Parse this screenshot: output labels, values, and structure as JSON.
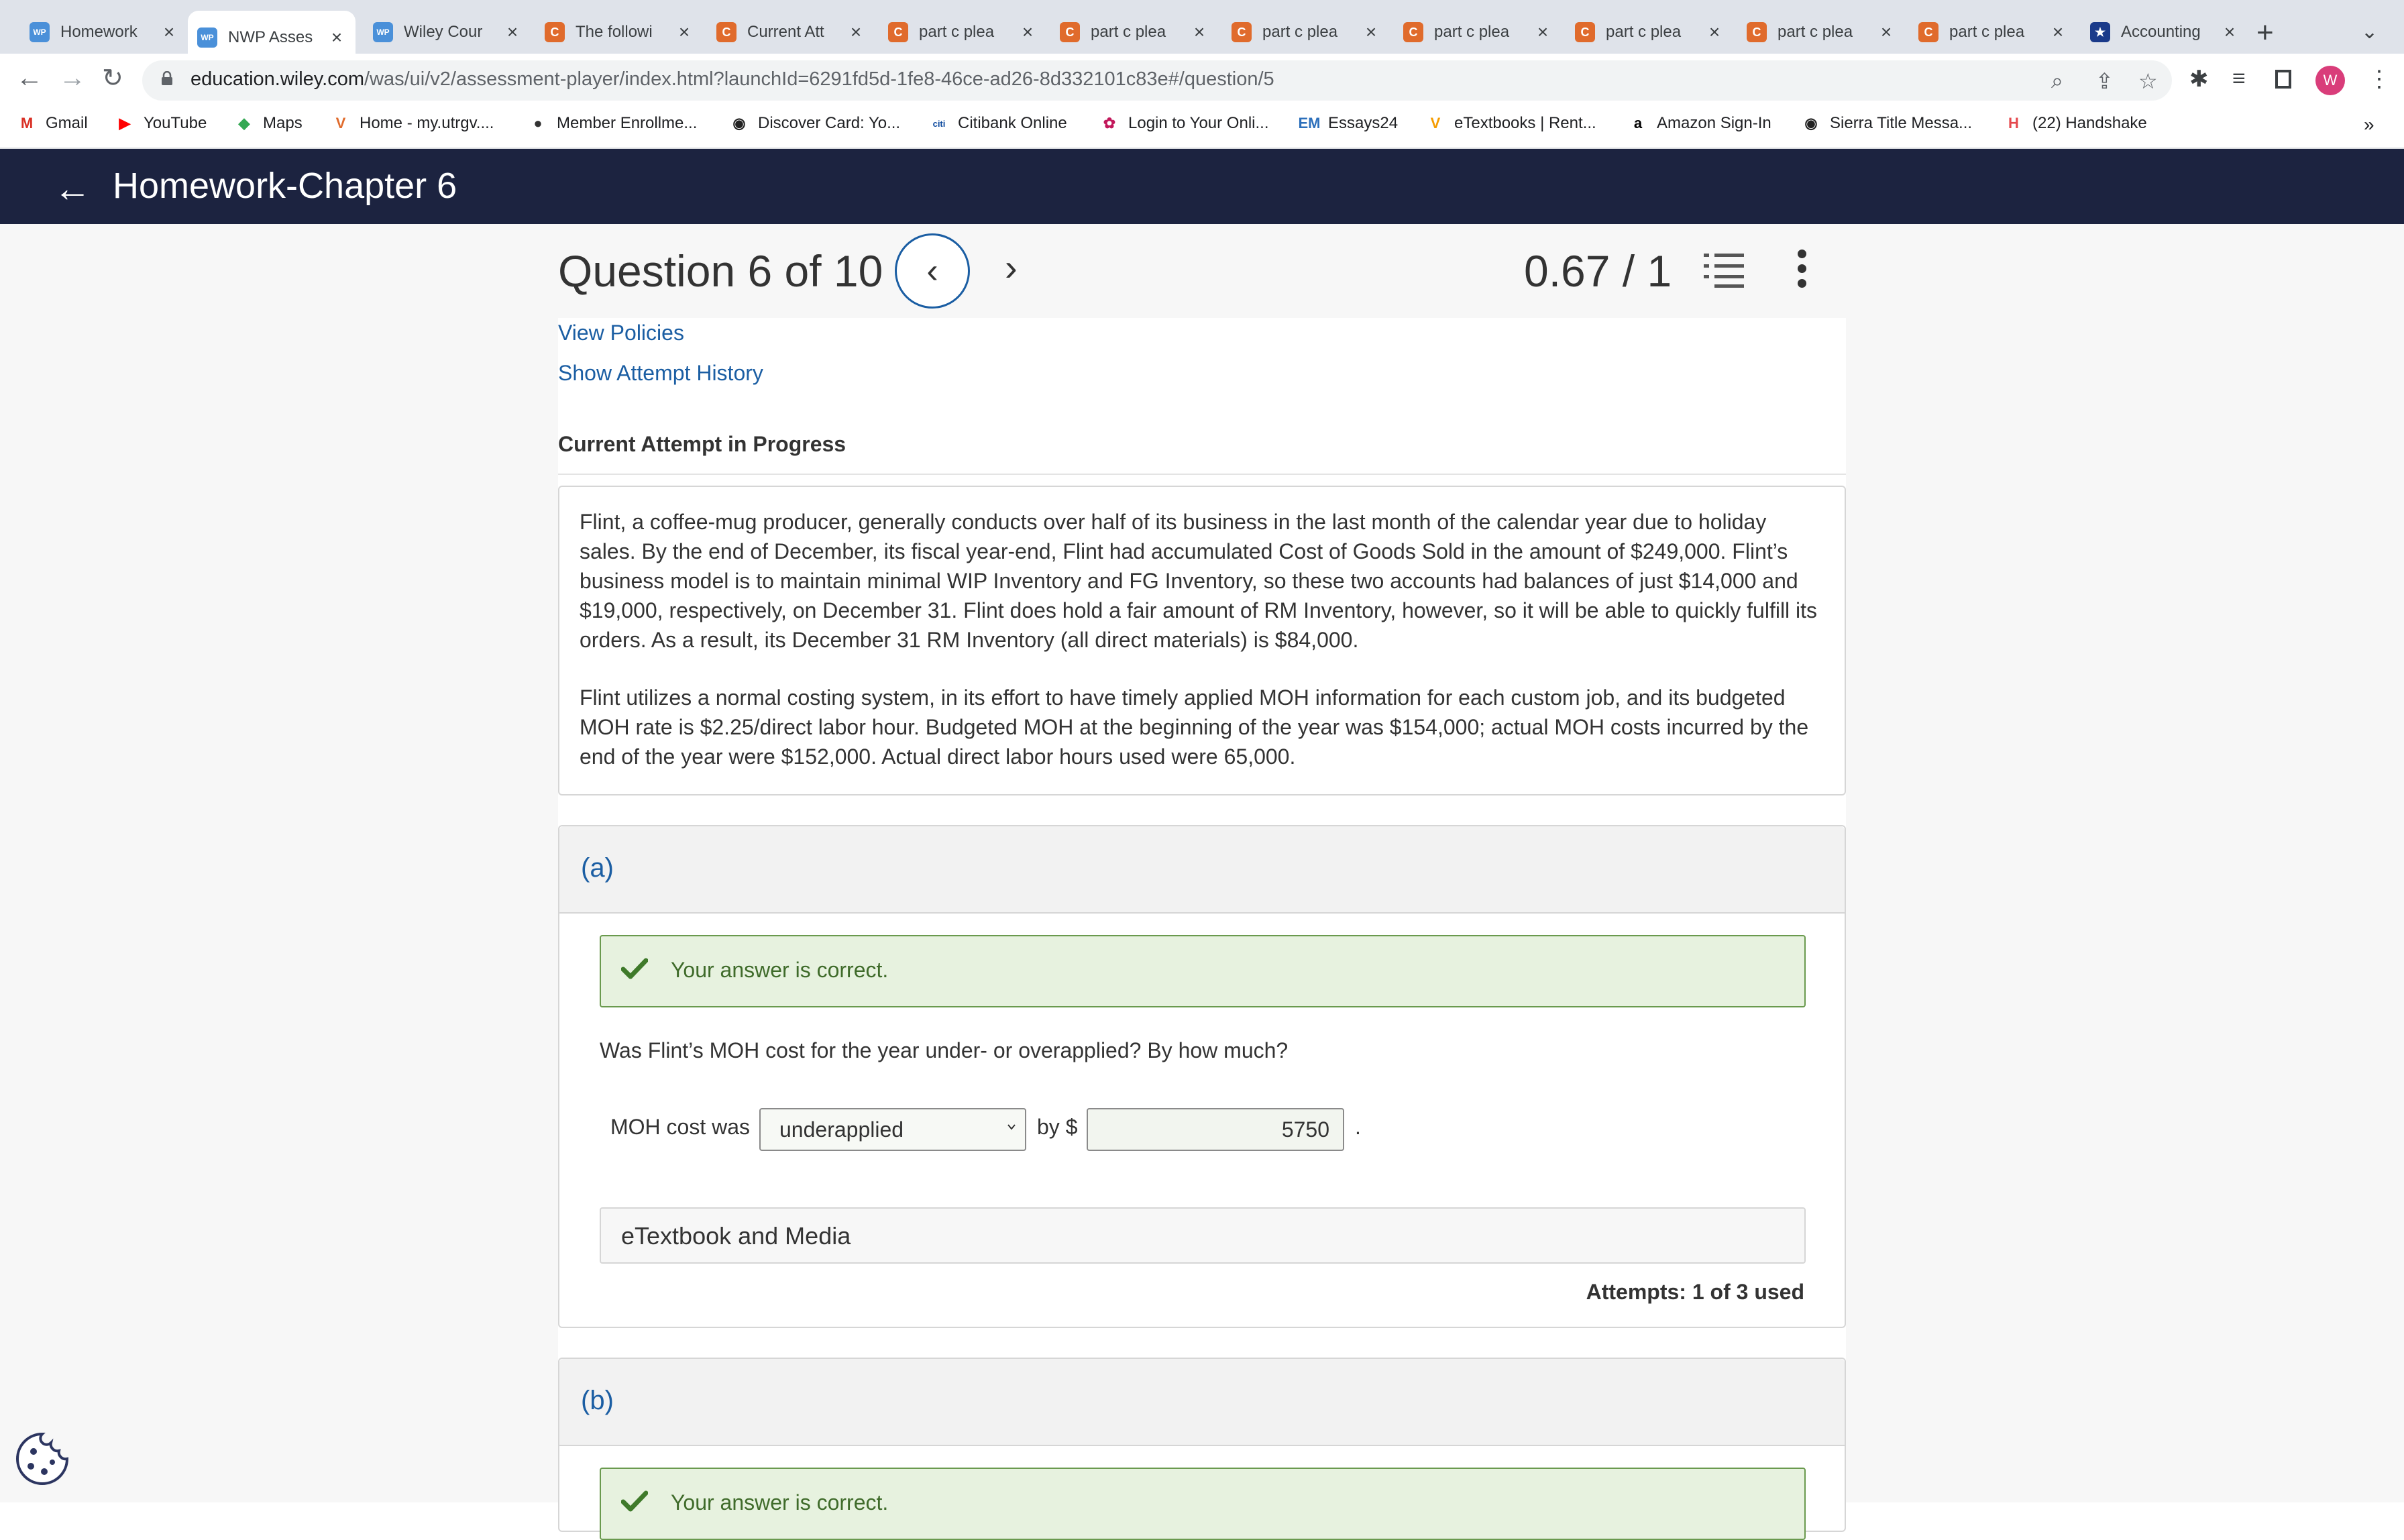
{
  "browser": {
    "tabs": [
      {
        "label": "Homework",
        "favicon": "wp"
      },
      {
        "label": "NWP Asses",
        "favicon": "wp",
        "active": true
      },
      {
        "label": "Wiley Cour",
        "favicon": "wp"
      },
      {
        "label": "The followi",
        "favicon": "c"
      },
      {
        "label": "Current Att",
        "favicon": "c"
      },
      {
        "label": "part c plea",
        "favicon": "c"
      },
      {
        "label": "part c plea",
        "favicon": "c"
      },
      {
        "label": "part c plea",
        "favicon": "c"
      },
      {
        "label": "part c plea",
        "favicon": "c"
      },
      {
        "label": "part c plea",
        "favicon": "c"
      },
      {
        "label": "part c plea",
        "favicon": "c"
      },
      {
        "label": "part c plea",
        "favicon": "c"
      },
      {
        "label": "Accounting",
        "favicon": "star"
      }
    ],
    "url_host": "education.wiley.com",
    "url_path": "/was/ui/v2/assessment-player/index.html?launchId=6291fd5d-1fe8-46ce-ad26-8d332101c83e#/question/5",
    "avatar_letter": "W",
    "bookmarks": [
      {
        "label": "Gmail",
        "icon": "M"
      },
      {
        "label": "YouTube",
        "icon": "▶"
      },
      {
        "label": "Maps",
        "icon": "◆"
      },
      {
        "label": "Home - my.utrgv....",
        "icon": "V"
      },
      {
        "label": "Member Enrollme...",
        "icon": "●"
      },
      {
        "label": "Discover Card: Yo...",
        "icon": "◉"
      },
      {
        "label": "Citibank Online",
        "icon": "citi"
      },
      {
        "label": "Login to Your Onli...",
        "icon": "✿"
      },
      {
        "label": "Essays24",
        "icon": "EM"
      },
      {
        "label": "eTextbooks | Rent...",
        "icon": "V"
      },
      {
        "label": "Amazon Sign-In",
        "icon": "a"
      },
      {
        "label": "Sierra Title Messa...",
        "icon": "◉"
      },
      {
        "label": "(22) Handshake",
        "icon": "H"
      }
    ],
    "bookmarks_overflow": "»"
  },
  "app": {
    "title": "Homework-Chapter 6"
  },
  "question": {
    "title": "Question 6 of 10",
    "score": "0.67 / 1",
    "view_policies": "View Policies",
    "show_history": "Show Attempt History",
    "attempt_heading": "Current Attempt in Progress",
    "problem_paragraphs": [
      "Flint, a coffee-mug producer, generally conducts over half of its business in the last month of the calendar year due to holiday sales. By the end of December, its fiscal year-end, Flint had accumulated Cost of Goods Sold in the amount of $249,000. Flint’s business model is to maintain minimal WIP Inventory and FG Inventory, so these two accounts had balances of just $14,000 and $19,000, respectively, on December 31. Flint does hold a fair amount of RM Inventory, however, so it will be able to quickly fulfill its orders. As a result, its December 31 RM Inventory (all direct materials) is $84,000.",
      "Flint utilizes a normal costing system, in its effort to have timely applied MOH information for each custom job, and its budgeted MOH rate is $2.25/direct labor hour. Budgeted MOH at the beginning of the year was $154,000; actual MOH costs incurred by the end of the year were $152,000. Actual direct labor hours used were 65,000."
    ]
  },
  "part_a": {
    "label": "(a)",
    "feedback": "Your answer is correct.",
    "prompt": "Was Flint’s MOH cost for the year under- or overapplied? By how much?",
    "moh_label": "MOH cost was",
    "selected_option": "underapplied",
    "by_label": "by $",
    "amount": "5750",
    "period": ".",
    "etextbook": "eTextbook and Media",
    "attempts": "Attempts: 1 of 3 used"
  },
  "part_b": {
    "label": "(b)",
    "feedback": "Your answer is correct."
  },
  "colors": {
    "appbar": "#1c2340",
    "link": "#1b5ea3",
    "success_bg": "#e7f2df",
    "success_border": "#6a9a4e"
  }
}
